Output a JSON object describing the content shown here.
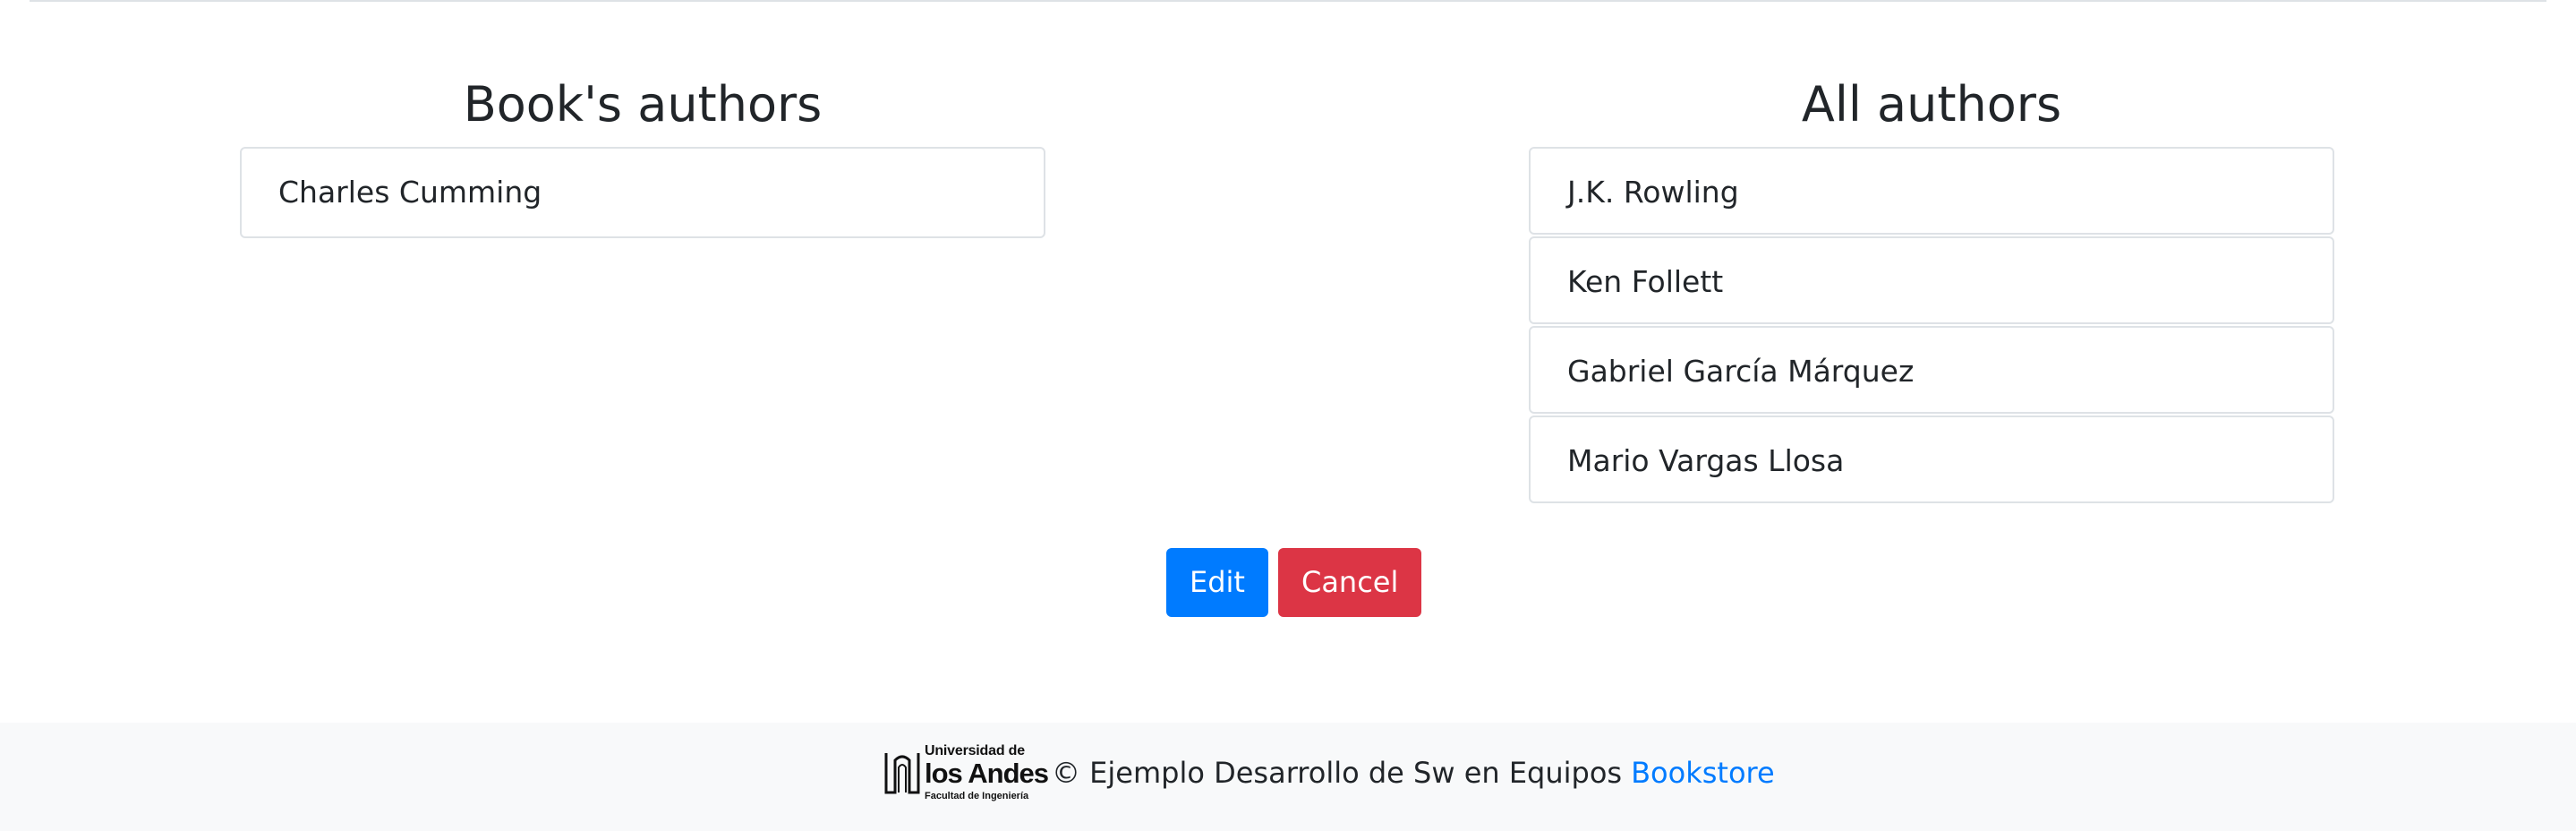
{
  "books_authors": {
    "title": "Book's authors",
    "items": [
      "Charles Cumming"
    ]
  },
  "all_authors": {
    "title": "All authors",
    "items": [
      "J.K. Rowling",
      "Ken Follett",
      "Gabriel García Márquez",
      "Mario Vargas Llosa"
    ]
  },
  "actions": {
    "edit_label": "Edit",
    "cancel_label": "Cancel"
  },
  "footer": {
    "logo": {
      "line1": "Universidad de",
      "line2": "los Andes",
      "line3": "Facultad de Ingeniería"
    },
    "text": "© Ejemplo Desarrollo de Sw en Equipos",
    "link_label": "Bookstore"
  },
  "colors": {
    "primary": "#007bff",
    "danger": "#dc3545",
    "footer_bg": "#f8f9fa",
    "border": "#dee2e6"
  }
}
